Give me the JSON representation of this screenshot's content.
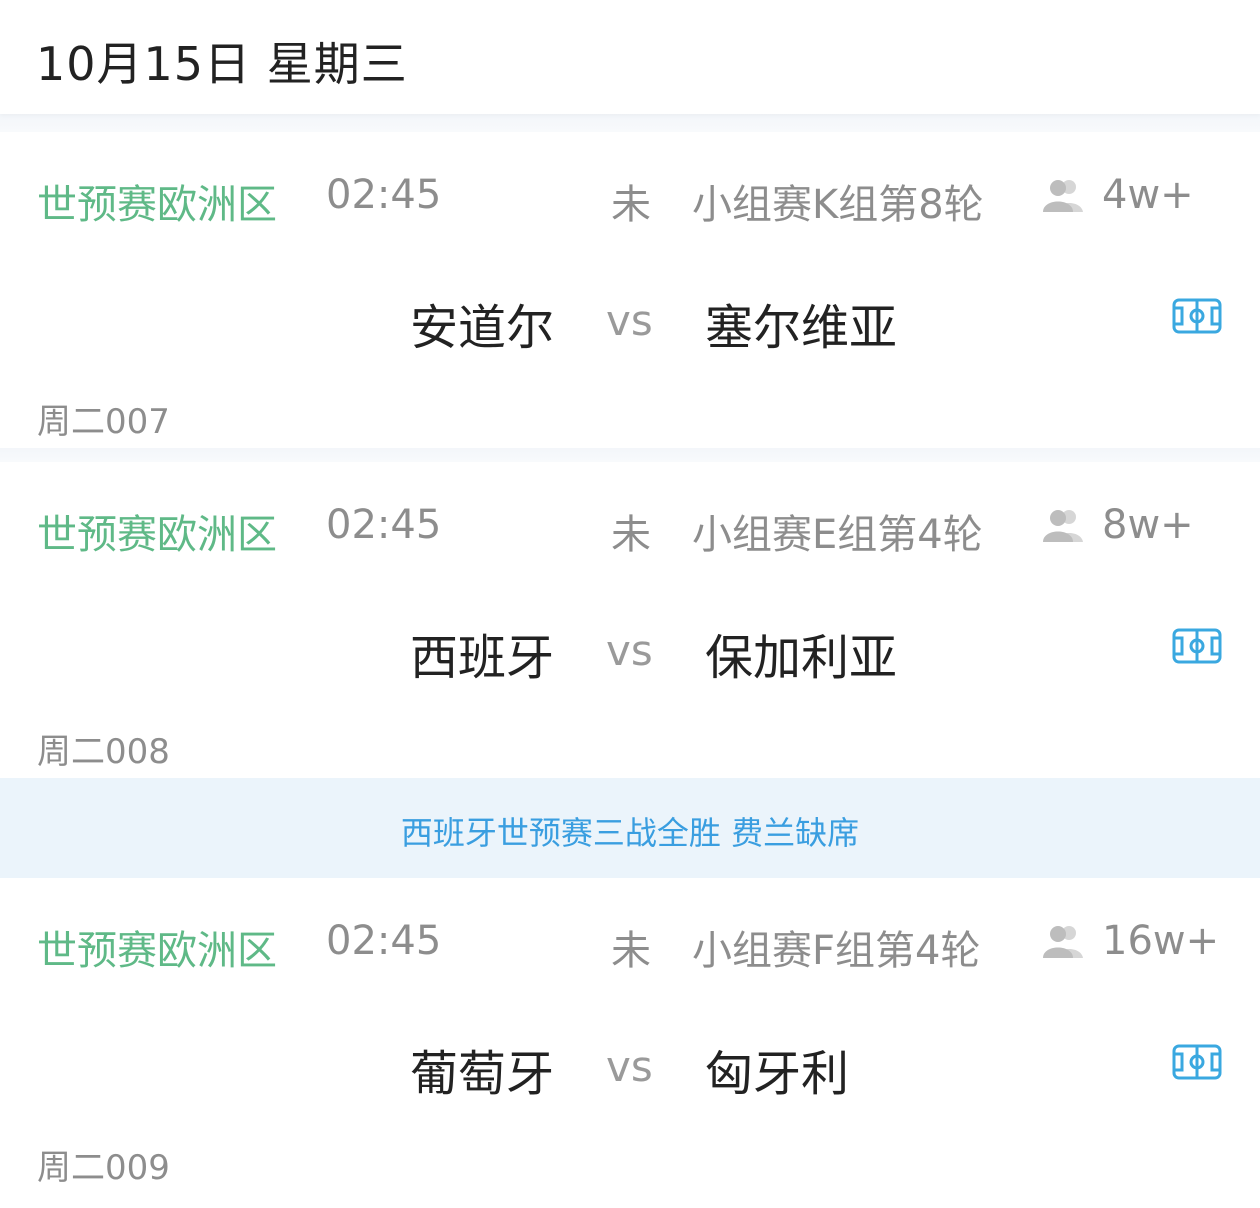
{
  "header": {
    "date_title": "10月15日  星期三"
  },
  "matches": [
    {
      "league": "世预赛欧洲区",
      "time": "02:45",
      "status": "未",
      "round": "小组赛K组第8轮",
      "viewers": "4w+",
      "home": "安道尔",
      "vs": "vs",
      "away": "塞尔维亚",
      "code": "周二007"
    },
    {
      "league": "世预赛欧洲区",
      "time": "02:45",
      "status": "未",
      "round": "小组赛E组第4轮",
      "viewers": "8w+",
      "home": "西班牙",
      "vs": "vs",
      "away": "保加利亚",
      "code": "周二008"
    },
    {
      "league": "世预赛欧洲区",
      "time": "02:45",
      "status": "未",
      "round": "小组赛F组第4轮",
      "viewers": "16w+",
      "home": "葡萄牙",
      "vs": "vs",
      "away": "匈牙利",
      "code": "周二009"
    }
  ],
  "news_banner": {
    "text": "西班牙世预赛三战全胜 费兰缺席"
  },
  "colors": {
    "league_green": "#5fb987",
    "accent_blue": "#3a9ee0",
    "muted_gray": "#8d8d8d",
    "banner_bg": "#ebf4fb"
  },
  "icons": {
    "viewers": "people-icon",
    "field": "football-field-icon"
  }
}
